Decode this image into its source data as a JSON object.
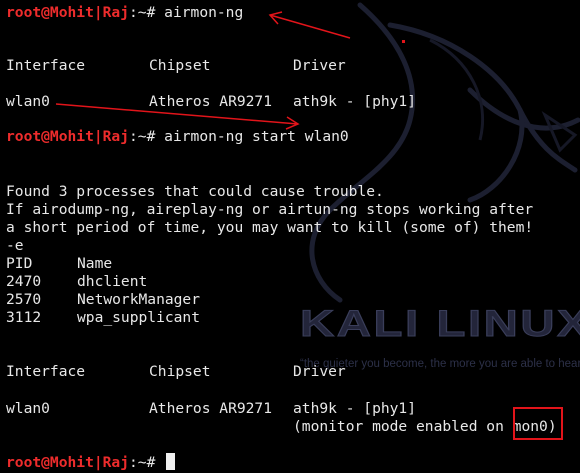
{
  "prompt": {
    "user": "root@Mohit|Raj",
    "separator": ":~# "
  },
  "commands": {
    "first": "airmon-ng",
    "second": "airmon-ng start wlan0"
  },
  "table_headers": {
    "interface": "Interface",
    "chipset": "Chipset",
    "driver": "Driver"
  },
  "first_table": {
    "interface": "wlan0",
    "chipset": "Atheros AR9271",
    "driver": "ath9k - [phy1]"
  },
  "warning": {
    "line1": "Found 3 processes that could cause trouble.",
    "line2": "If airodump-ng, aireplay-ng or airtun-ng stops working after",
    "line3": "a short period of time, you may want to kill (some of) them!",
    "line4": "-e"
  },
  "process_headers": {
    "pid": "PID",
    "name": "Name"
  },
  "processes": [
    {
      "pid": "2470",
      "name": "dhclient"
    },
    {
      "pid": "2570",
      "name": "NetworkManager"
    },
    {
      "pid": "3112",
      "name": "wpa_supplicant"
    }
  ],
  "second_table": {
    "interface": "wlan0",
    "chipset": "Atheros AR9271",
    "driver": "ath9k - [phy1]",
    "monitor_prefix": "(monitor mode enabled on ",
    "monitor_iface": "mon0",
    "monitor_suffix": ")"
  },
  "wallpaper": {
    "brand": "KALI LINUX",
    "tagline": "“the quieter you become, the more you are able to hear”"
  },
  "colors": {
    "background": "#000000",
    "text": "#e8e8e8",
    "prompt_user": "#ee2c2c",
    "annotation": "#e2141a"
  }
}
